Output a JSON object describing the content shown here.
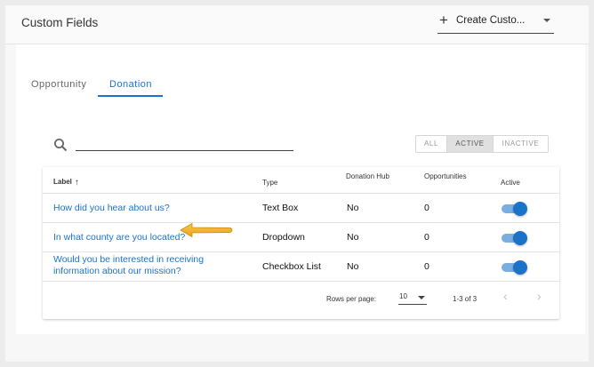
{
  "header": {
    "title": "Custom Fields",
    "create_button": {
      "icon": "plus-icon",
      "label": "Create Custo...",
      "dropdown_icon": "caret-down-icon"
    }
  },
  "tabs": [
    {
      "label": "Opportunity",
      "active": false
    },
    {
      "label": "Donation",
      "active": true
    }
  ],
  "search": {
    "icon": "search-icon",
    "value": "",
    "placeholder": ""
  },
  "filters": [
    {
      "label": "ALL",
      "selected": false
    },
    {
      "label": "ACTIVE",
      "selected": true
    },
    {
      "label": "INACTIVE",
      "selected": false
    }
  ],
  "table": {
    "columns": {
      "label": "Label",
      "sort_icon": "arrow-up-icon",
      "type": "Type",
      "donation_hub": "Donation Hub",
      "opportunities": "Opportunities",
      "active": "Active"
    },
    "rows": [
      {
        "label": "How did you hear about us?",
        "type": "Text Box",
        "donation_hub": "No",
        "opportunities": "0",
        "active": true
      },
      {
        "label": "In what county are you located?",
        "type": "Dropdown",
        "donation_hub": "No",
        "opportunities": "0",
        "active": true
      },
      {
        "label": "Would you be interested in receiving information about our mission?",
        "type": "Checkbox List",
        "donation_hub": "No",
        "opportunities": "0",
        "active": true
      }
    ]
  },
  "pagination": {
    "rows_per_page_label": "Rows per page:",
    "rows_per_page_value": "10",
    "range": "1-3 of 3",
    "prev_icon": "chevron-left-icon",
    "next_icon": "chevron-right-icon"
  },
  "colors": {
    "accent": "#1a73c8",
    "toggle_track": "#7aaee0",
    "annotation_arrow": "#f2b632"
  }
}
